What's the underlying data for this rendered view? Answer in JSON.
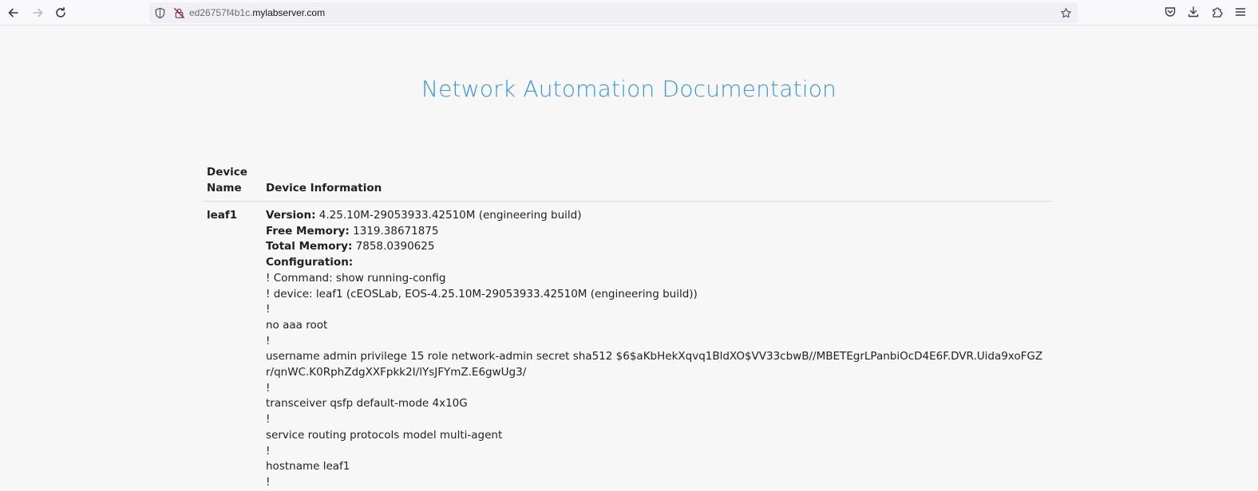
{
  "browser": {
    "url_subdomain": "ed26757f4b1c.",
    "url_domain": "mylabserver.com"
  },
  "page": {
    "title": "Network Automation Documentation"
  },
  "table": {
    "headers": {
      "device_name": "Device Name",
      "device_information": "Device Information"
    },
    "rows": [
      {
        "device_name": "leaf1",
        "version_label": "Version:",
        "version_value": " 4.25.10M-29053933.42510M (engineering build)",
        "free_memory_label": "Free Memory:",
        "free_memory_value": " 1319.38671875",
        "total_memory_label": "Total Memory:",
        "total_memory_value": " 7858.0390625",
        "configuration_label": "Configuration:",
        "config_lines": [
          "! Command: show running-config",
          "! device: leaf1 (cEOSLab, EOS-4.25.10M-29053933.42510M (engineering build))",
          "!",
          "no aaa root",
          "!",
          "username admin privilege 15 role network-admin secret sha512 $6$aKbHekXqvq1BldXO$VV33cbwB//MBETEgrLPanbiOcD4E6F.DVR.Uida9xoFGZr/qnWC.K0RphZdgXXFpkk2I/lYsJFYmZ.E6gwUg3/",
          "!",
          "transceiver qsfp default-mode 4x10G",
          "!",
          "service routing protocols model multi-agent",
          "!",
          "hostname leaf1",
          "!"
        ]
      }
    ]
  },
  "icons": {
    "back": "arrow-left-icon",
    "forward": "arrow-right-icon",
    "reload": "reload-icon",
    "tracking": "shield-icon",
    "insecure": "lock-strike-icon",
    "bookmark": "star-icon",
    "pocket": "pocket-icon",
    "downloads": "download-icon",
    "extensions": "puzzle-icon",
    "menu": "hamburger-menu-icon"
  },
  "colors": {
    "title": "#3a97d8",
    "insecure_icon": "#d70022"
  }
}
